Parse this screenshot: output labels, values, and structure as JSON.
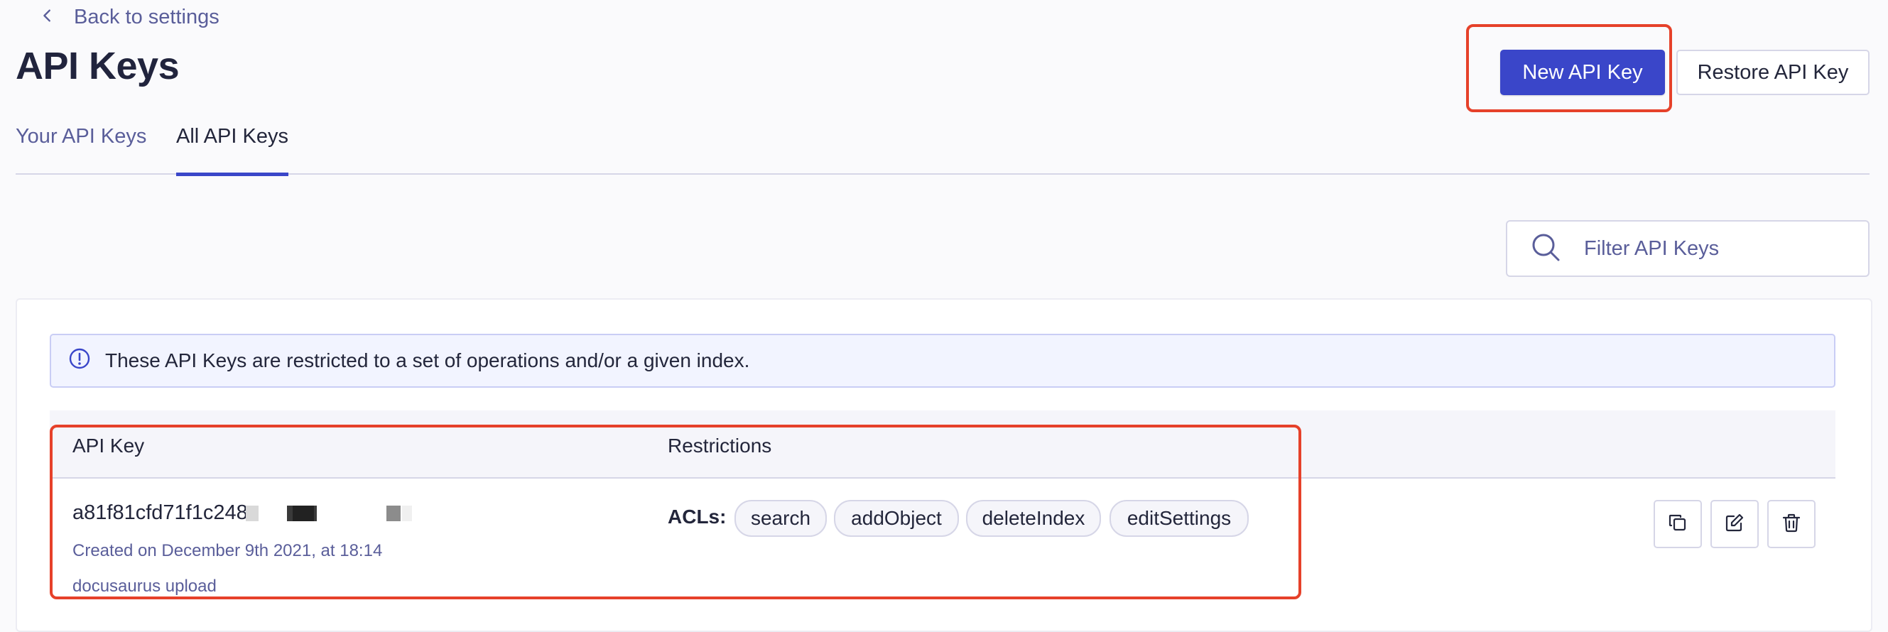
{
  "back_link": {
    "label": "Back to settings",
    "icon": "chevron-left-icon"
  },
  "page_title": "API Keys",
  "buttons": {
    "new_key": "New API Key",
    "restore_key": "Restore API Key"
  },
  "tabs": [
    {
      "label": "Your API Keys",
      "active": false
    },
    {
      "label": "All API Keys",
      "active": true
    }
  ],
  "filter": {
    "placeholder": "Filter API Keys",
    "icon": "search-icon"
  },
  "info_banner": {
    "icon": "info-icon",
    "text": "These API Keys are restricted to a set of operations and/or a given index."
  },
  "table": {
    "columns": [
      "API Key",
      "Restrictions"
    ],
    "rows": [
      {
        "key": "a81f81cfd71f1c248",
        "created": "Created on December 9th 2021, at 18:14",
        "description": "docusaurus upload",
        "acl_label": "ACLs:",
        "acls": [
          "search",
          "addObject",
          "deleteIndex",
          "editSettings"
        ],
        "actions": [
          "copy-icon",
          "edit-icon",
          "trash-icon"
        ]
      }
    ]
  },
  "colors": {
    "primary": "#3a46c9",
    "highlight": "#e6412a",
    "muted_text": "#5a5e9a",
    "text": "#23263b"
  }
}
